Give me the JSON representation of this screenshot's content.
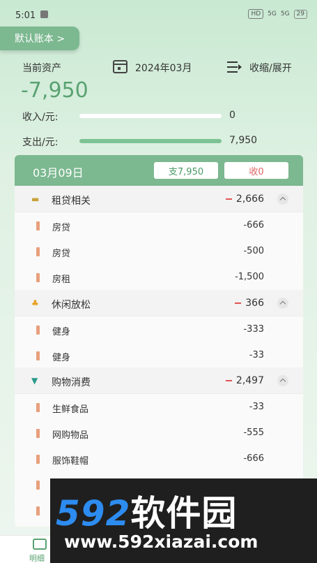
{
  "status_bar": {
    "time": "5:01",
    "network_badge": "HD",
    "signal_1": "5G",
    "signal_2": "5G",
    "battery": "29"
  },
  "ledger_tab": {
    "label": "默认账本 >"
  },
  "summary": {
    "assets_label": "当前资产",
    "month": "2024年03月",
    "collapse_label": "收缩/展开",
    "total": "-7,950",
    "income_label": "收入/元:",
    "income_value": "0",
    "income_ratio": 0,
    "expense_label": "支出/元:",
    "expense_value": "7,950",
    "expense_ratio": 1
  },
  "day_card": {
    "date": "03月09日",
    "expense_chip": "支7,950",
    "income_chip": "收0",
    "categories": [
      {
        "name": "租贷相关",
        "amount": "2,666",
        "icon": "money-icon",
        "icon_color": "#c8a23a",
        "items": [
          {
            "name": "房贷",
            "amount": "-666"
          },
          {
            "name": "房贷",
            "amount": "-500"
          },
          {
            "name": "房租",
            "amount": "-1,500"
          }
        ]
      },
      {
        "name": "休闲放松",
        "amount": "366",
        "icon": "palm-tree-icon",
        "icon_color": "#e5a020",
        "items": [
          {
            "name": "健身",
            "amount": "-333"
          },
          {
            "name": "健身",
            "amount": "-33"
          }
        ]
      },
      {
        "name": "购物消费",
        "amount": "2,497",
        "icon": "shopping-cart-icon",
        "icon_color": "#2a9a8a",
        "items": [
          {
            "name": "生鲜食品",
            "amount": "-33"
          },
          {
            "name": "网购物品",
            "amount": "-555"
          },
          {
            "name": "服饰鞋帽",
            "amount": "-666"
          }
        ]
      }
    ]
  },
  "bottom_nav": {
    "label": "明细"
  },
  "watermark": {
    "brand_number": "592",
    "brand_text": "软件园",
    "url": "www.592xiazai.com"
  },
  "colors": {
    "accent": "#7cb890",
    "total": "#5aa272",
    "expense_marker": "#e05555",
    "item_marker": "#e8a07c"
  }
}
